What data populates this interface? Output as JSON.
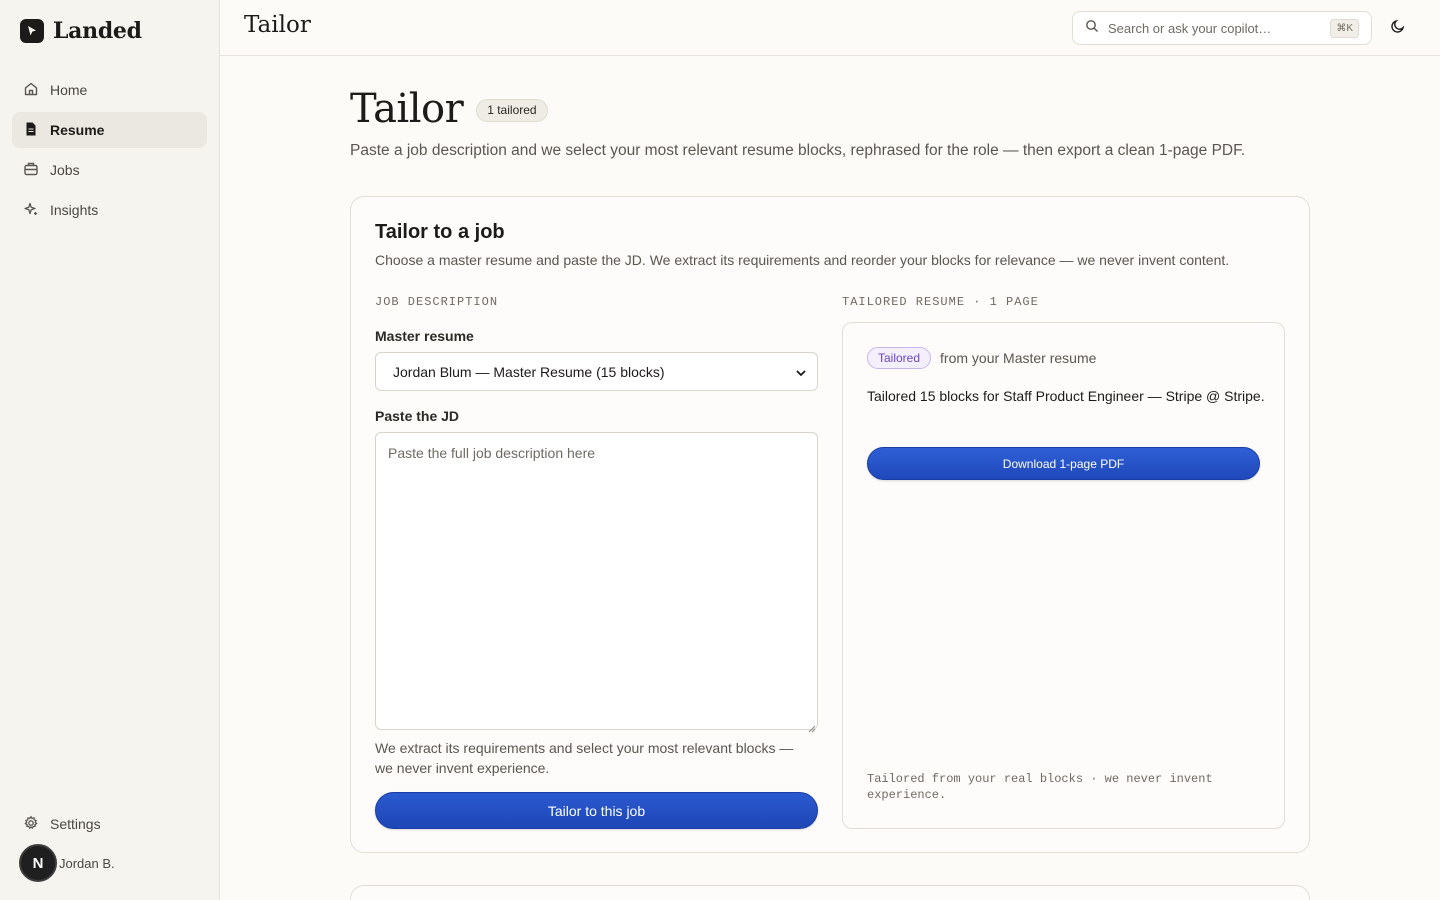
{
  "app": {
    "name": "Landed"
  },
  "sidebar": {
    "items": [
      {
        "label": "Home",
        "icon": "home-icon"
      },
      {
        "label": "Resume",
        "icon": "document-icon",
        "active": true
      },
      {
        "label": "Jobs",
        "icon": "briefcase-icon"
      },
      {
        "label": "Insights",
        "icon": "sparkle-icon"
      }
    ],
    "settings_label": "Settings",
    "user": {
      "initial": "N",
      "name": "Jordan B."
    }
  },
  "header": {
    "title": "Tailor",
    "search_placeholder": "Search or ask your copilot…",
    "search_shortcut": "⌘K"
  },
  "main": {
    "title": "Tailor",
    "badge": "1 tailored",
    "subtitle": "Paste a job description and we select your most relevant resume blocks, rephrased for the role — then export a clean 1-page PDF.",
    "card": {
      "title": "Tailor to a job",
      "subtitle": "Choose a master resume and paste the JD. We extract its requirements and reorder your blocks for relevance — we never invent content.",
      "left": {
        "section_label": "JOB DESCRIPTION",
        "master_label": "Master resume",
        "master_value": "Jordan Blum — Master Resume (15 blocks)",
        "jd_label": "Paste the JD",
        "jd_placeholder": "Paste the full job description here",
        "helper": "We extract its requirements and select your most relevant blocks — we never invent experience.",
        "button": "Tailor to this job"
      },
      "right": {
        "section_label": "TAILORED RESUME · 1 PAGE",
        "tag": "Tailored",
        "tag_from": "from your Master resume",
        "summary": "Tailored 15 blocks for Staff Product Engineer — Stripe @ Stripe.",
        "download_button": "Download 1-page PDF",
        "footnote": "Tailored from your real blocks · we never invent experience."
      }
    }
  },
  "colors": {
    "accent": "#1e46b6",
    "tag_purple": "#6b46c1",
    "background": "#fcfbf8"
  }
}
